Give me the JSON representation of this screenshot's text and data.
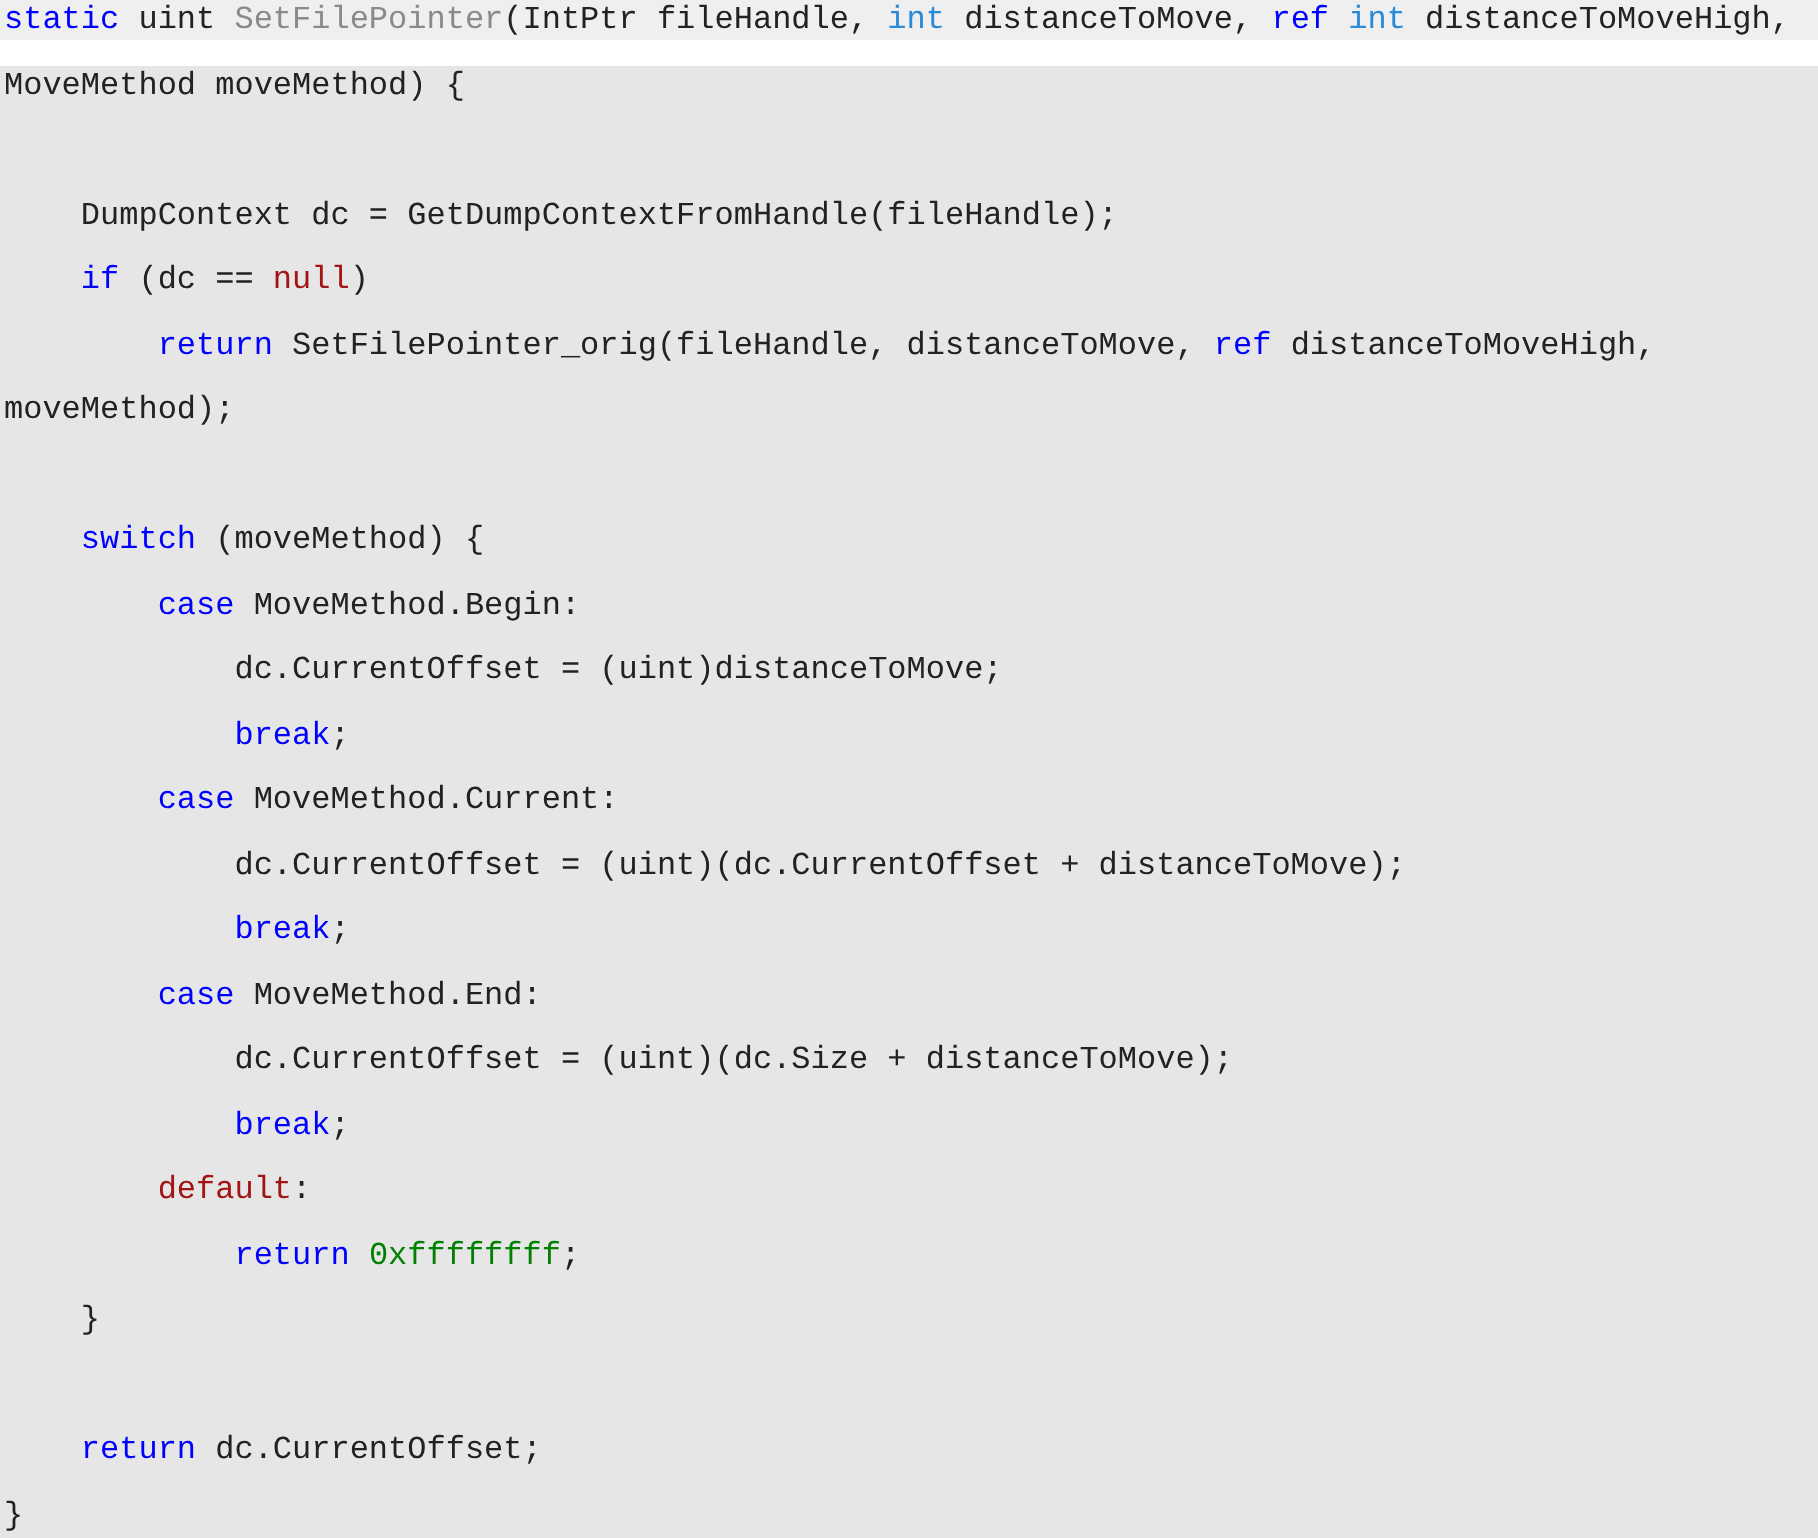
{
  "code_lines": [
    {
      "highlighted": true,
      "tokens": [
        {
          "kind": "keyword",
          "text": "static"
        },
        {
          "kind": "plain",
          "text": " uint "
        },
        {
          "kind": "function",
          "text": "SetFilePointer"
        },
        {
          "kind": "plain",
          "text": "(IntPtr fileHandle, "
        },
        {
          "kind": "type",
          "text": "int"
        },
        {
          "kind": "plain",
          "text": " distanceToMove, "
        },
        {
          "kind": "keyword",
          "text": "ref "
        },
        {
          "kind": "type",
          "text": "int"
        },
        {
          "kind": "plain",
          "text": " distanceToMoveHigh,"
        }
      ]
    },
    {
      "highlighted": false,
      "tokens": [
        {
          "kind": "plain",
          "text": "MoveMethod moveMethod) {"
        }
      ]
    },
    {
      "highlighted": false
    },
    {
      "highlighted": false,
      "tokens": [
        {
          "kind": "plain",
          "text": "    DumpContext dc = GetDumpContextFromHandle(fileHandle);"
        }
      ]
    },
    {
      "highlighted": false,
      "tokens": [
        {
          "kind": "keyword",
          "text": "    if"
        },
        {
          "kind": "plain",
          "text": " (dc == "
        },
        {
          "kind": "literal",
          "text": "null"
        },
        {
          "kind": "plain",
          "text": ")"
        }
      ]
    },
    {
      "highlighted": false,
      "tokens": [
        {
          "kind": "keyword",
          "text": "        return"
        },
        {
          "kind": "plain",
          "text": " SetFilePointer_orig(fileHandle, distanceToMove, "
        },
        {
          "kind": "keyword",
          "text": "ref"
        },
        {
          "kind": "plain",
          "text": " distanceToMoveHigh,"
        }
      ]
    },
    {
      "highlighted": false,
      "tokens": [
        {
          "kind": "plain",
          "text": "moveMethod);"
        }
      ]
    },
    {
      "highlighted": false
    },
    {
      "highlighted": false,
      "tokens": [
        {
          "kind": "keyword",
          "text": "    switch"
        },
        {
          "kind": "plain",
          "text": " (moveMethod) {"
        }
      ]
    },
    {
      "highlighted": false,
      "tokens": [
        {
          "kind": "keyword",
          "text": "        case"
        },
        {
          "kind": "plain",
          "text": " MoveMethod.Begin:"
        }
      ]
    },
    {
      "highlighted": false,
      "tokens": [
        {
          "kind": "plain",
          "text": "            dc.CurrentOffset = (uint)distanceToMove;"
        }
      ]
    },
    {
      "highlighted": false,
      "tokens": [
        {
          "kind": "keyword",
          "text": "            break"
        },
        {
          "kind": "plain",
          "text": ";"
        }
      ]
    },
    {
      "highlighted": false,
      "tokens": [
        {
          "kind": "keyword",
          "text": "        case"
        },
        {
          "kind": "plain",
          "text": " MoveMethod.Current:"
        }
      ]
    },
    {
      "highlighted": false,
      "tokens": [
        {
          "kind": "plain",
          "text": "            dc.CurrentOffset = (uint)(dc.CurrentOffset + distanceToMove);"
        }
      ]
    },
    {
      "highlighted": false,
      "tokens": [
        {
          "kind": "keyword",
          "text": "            break"
        },
        {
          "kind": "plain",
          "text": ";"
        }
      ]
    },
    {
      "highlighted": false,
      "tokens": [
        {
          "kind": "keyword",
          "text": "        case"
        },
        {
          "kind": "plain",
          "text": " MoveMethod.End:"
        }
      ]
    },
    {
      "highlighted": false,
      "tokens": [
        {
          "kind": "plain",
          "text": "            dc.CurrentOffset = (uint)(dc.Size + distanceToMove);"
        }
      ]
    },
    {
      "highlighted": false,
      "tokens": [
        {
          "kind": "keyword",
          "text": "            break"
        },
        {
          "kind": "plain",
          "text": ";"
        }
      ]
    },
    {
      "highlighted": false,
      "tokens": [
        {
          "kind": "literal",
          "text": "        default"
        },
        {
          "kind": "plain",
          "text": ":"
        }
      ]
    },
    {
      "highlighted": false,
      "tokens": [
        {
          "kind": "keyword",
          "text": "            return "
        },
        {
          "kind": "number",
          "text": "0xffffffff"
        },
        {
          "kind": "plain",
          "text": ";"
        }
      ]
    },
    {
      "highlighted": false,
      "tokens": [
        {
          "kind": "plain",
          "text": "    }"
        }
      ]
    },
    {
      "highlighted": false
    },
    {
      "highlighted": false,
      "tokens": [
        {
          "kind": "keyword",
          "text": "    return"
        },
        {
          "kind": "plain",
          "text": " dc.CurrentOffset;"
        }
      ]
    },
    {
      "highlighted": false,
      "tokens": [
        {
          "kind": "plain",
          "text": "}"
        }
      ]
    }
  ]
}
